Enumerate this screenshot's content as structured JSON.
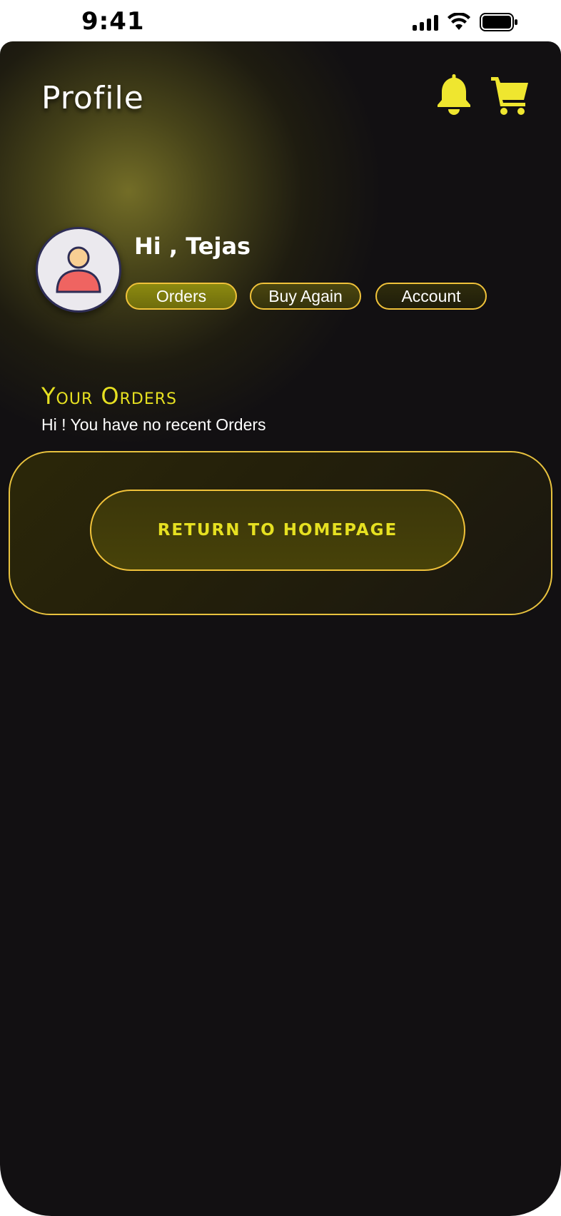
{
  "status_bar": {
    "time": "9:41"
  },
  "header": {
    "title": "Profile"
  },
  "icons": {
    "notification": "bell-icon",
    "cart": "cart-icon",
    "avatar": "user-avatar-icon"
  },
  "user": {
    "greeting": "Hi , Tejas"
  },
  "tabs": [
    {
      "label": "Orders",
      "active": true
    },
    {
      "label": "Buy Again",
      "active": false
    },
    {
      "label": "Account",
      "active": false
    }
  ],
  "orders": {
    "section_title": "Your Orders",
    "empty_message": "Hi ! You have no recent Orders",
    "return_label": "Return to Homepage"
  },
  "colors": {
    "accent": "#e6e021",
    "border": "#f0c23a",
    "background": "#121012",
    "active_tab": "#8c8a10"
  }
}
